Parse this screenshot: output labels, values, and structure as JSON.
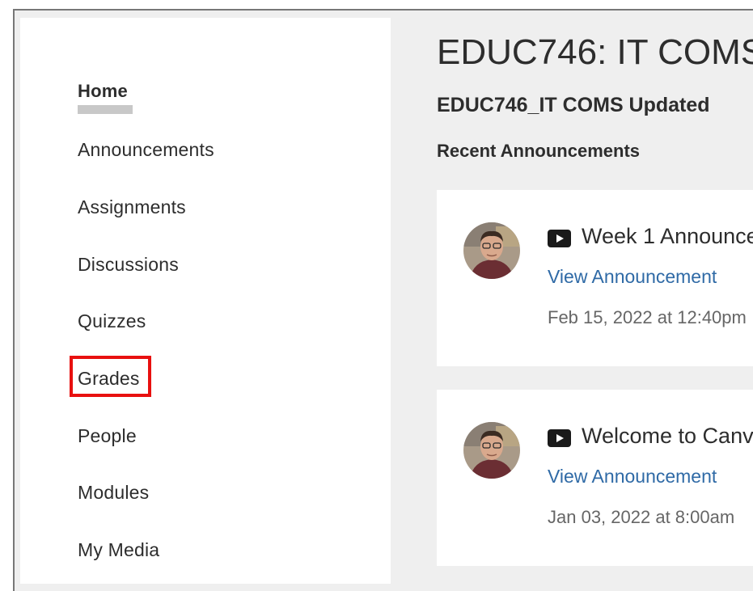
{
  "sidebar": {
    "items": [
      {
        "label": "Home",
        "active": true
      },
      {
        "label": "Announcements"
      },
      {
        "label": "Assignments"
      },
      {
        "label": "Discussions"
      },
      {
        "label": "Quizzes"
      },
      {
        "label": "Grades",
        "highlighted": true
      },
      {
        "label": "People"
      },
      {
        "label": "Modules"
      },
      {
        "label": "My Media"
      }
    ]
  },
  "main": {
    "title": "EDUC746: IT COMS",
    "subtitle": "EDUC746_IT COMS Updated",
    "recent_heading": "Recent Announcements",
    "announcements": [
      {
        "title": "Week 1 Announce",
        "link": "View Announcement",
        "date": "Feb 15, 2022 at 12:40pm",
        "icon": "video-icon"
      },
      {
        "title": "Welcome to Canv",
        "link": "View Announcement",
        "date": "Jan 03, 2022 at 8:00am",
        "icon": "video-icon"
      }
    ]
  },
  "colors": {
    "highlight": "#e8100f",
    "link": "#2f6aa6",
    "background": "#efefef"
  }
}
